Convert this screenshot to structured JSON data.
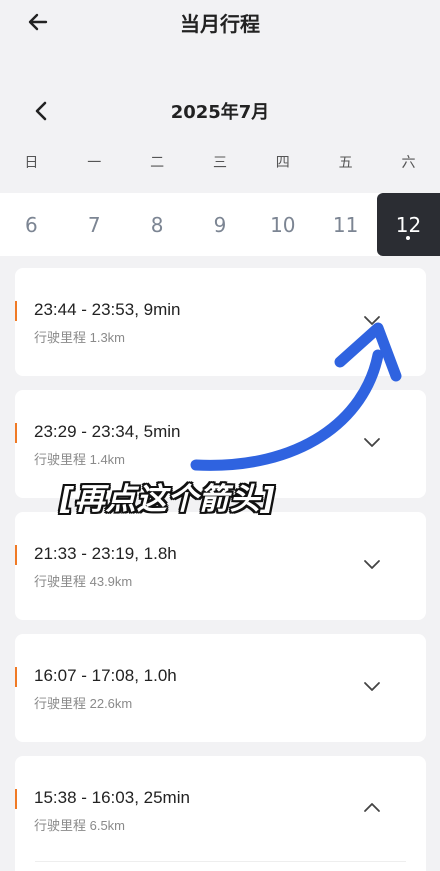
{
  "header": {
    "title": "当月行程"
  },
  "calendar": {
    "month_label": "2025年7月",
    "weekdays": [
      "日",
      "一",
      "二",
      "三",
      "四",
      "五",
      "六"
    ],
    "days": [
      "6",
      "7",
      "8",
      "9",
      "10",
      "11",
      "12"
    ],
    "selected_day": "12"
  },
  "trips": [
    {
      "time": "23:44 - 23:53, 9min",
      "distance": "行驶里程 1.3km",
      "expanded": false
    },
    {
      "time": "23:29 - 23:34, 5min",
      "distance": "行驶里程 1.4km",
      "expanded": false
    },
    {
      "time": "21:33 - 23:19, 1.8h",
      "distance": "行驶里程 43.9km",
      "expanded": false
    },
    {
      "time": "16:07 - 17:08, 1.0h",
      "distance": "行驶里程 22.6km",
      "expanded": false
    },
    {
      "time": "15:38 - 16:03, 25min",
      "distance": "行驶里程 6.5km",
      "expanded": true
    }
  ],
  "annotation": {
    "text": "[再点这个箭头]"
  },
  "colors": {
    "accent_orange": "#f07a25",
    "selected_day_bg": "#2b2d33",
    "annotation_arrow": "#2f63e0"
  }
}
